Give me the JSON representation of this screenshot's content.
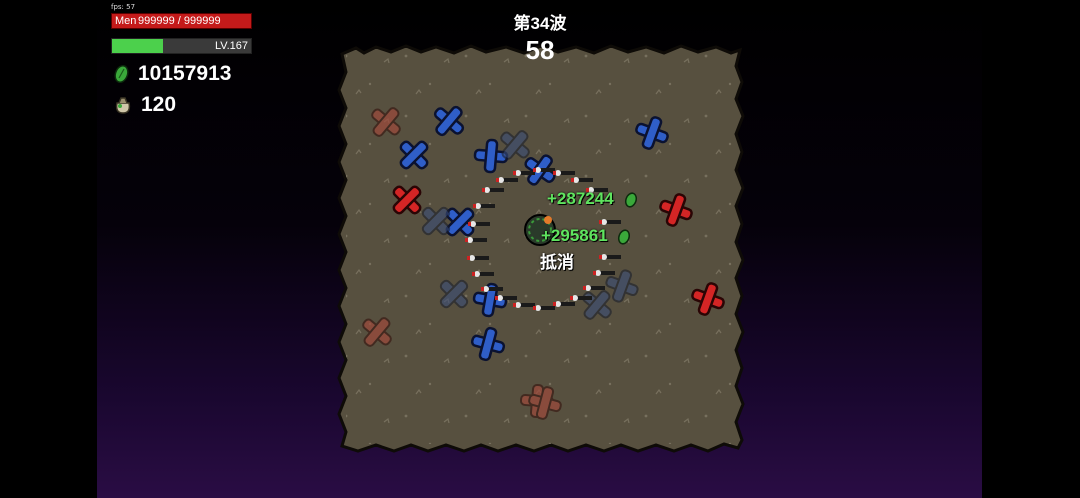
{
  "hud": {
    "fps": "fps: 57",
    "hp_label": "Men",
    "hp_value": "999999 / 999999",
    "hp_fraction": 1.0,
    "level": "LV.167",
    "xp_fraction": 0.37,
    "materials": "10157913",
    "bag_count": "120"
  },
  "wave": {
    "title": "第34波",
    "timer": "58"
  },
  "floating_text": {
    "gain_1": "+287244",
    "gain_2": "+295861",
    "blocked": "抵消"
  },
  "colors": {
    "hp": "#c41a1a",
    "xp": "#4cd04c",
    "arena_ground": "#57503f",
    "enemy_blue": "#2f5ec8",
    "enemy_red": "#d42525",
    "gain_text": "#5fe45f"
  },
  "icons": [
    "material-icon",
    "bag-icon",
    "enemy-cross-icon",
    "player-icon",
    "weapon-icon"
  ]
}
